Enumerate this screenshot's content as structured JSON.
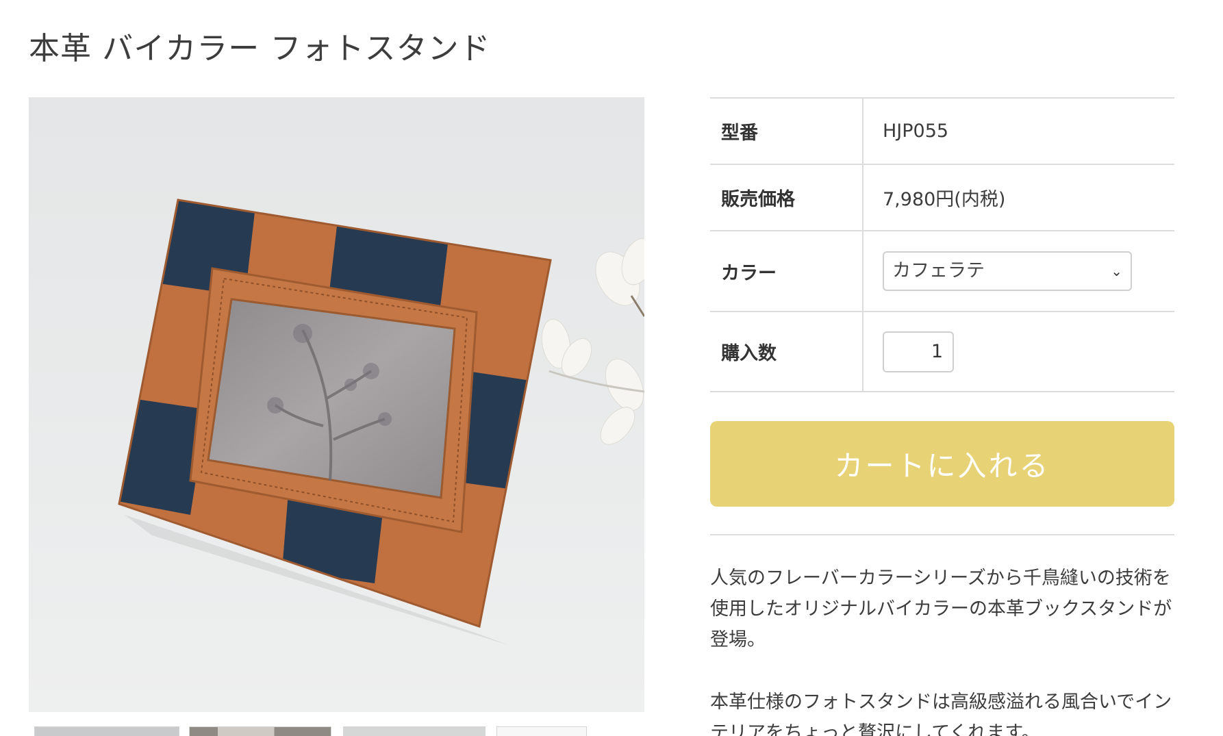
{
  "product": {
    "title": "本革 バイカラー フォトスタンド"
  },
  "spec": {
    "code_label": "型番",
    "code_value": "HJP055",
    "price_label": "販売価格",
    "price_value": "7,980円(内税)",
    "color_label": "カラー",
    "color_selected": "カフェラテ",
    "qty_label": "購入数",
    "qty_value": "1"
  },
  "cart": {
    "button_label": "カートに入れる",
    "button_color": "#e8d276"
  },
  "description": {
    "paragraph1": "人気のフレーバーカラーシリーズから千鳥縫いの技術を使用したオリジナルバイカラーの本革ブックスタンドが登場。",
    "paragraph2": "本革仕様のフォトスタンドは高級感溢れる風合いでインテリアをちょっと贅沢にしてくれます。"
  },
  "colors": {
    "leather_tan": "#c0713f",
    "leather_navy": "#263a52",
    "background": "#e9eaea"
  }
}
